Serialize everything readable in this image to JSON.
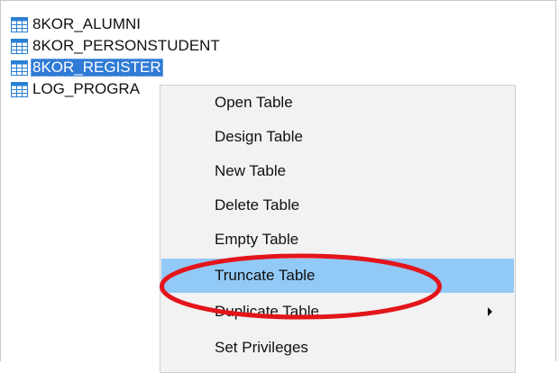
{
  "tables": [
    {
      "name": "8KOR_ALUMNI",
      "selected": false
    },
    {
      "name": "8KOR_PERSONSTUDENT",
      "selected": false
    },
    {
      "name": "8KOR_REGISTER",
      "selected": true
    },
    {
      "name": "LOG_PROGRA",
      "selected": false
    }
  ],
  "context_menu": {
    "items": [
      {
        "label": "Open Table"
      },
      {
        "label": "Design Table"
      },
      {
        "label": "New Table"
      },
      {
        "label": "Delete Table"
      },
      {
        "label": "Empty Table"
      },
      {
        "label": "Truncate Table",
        "highlighted": true
      },
      {
        "label": "Duplicate Table",
        "has_submenu": true
      },
      {
        "label": "Set Privileges"
      }
    ]
  },
  "colors": {
    "selection": "#2f7bd6",
    "menu_highlight": "#91c9f7",
    "annotation": "#e3151b",
    "table_icon": "#2a7fd4"
  },
  "icons": {
    "table": "table-grid-icon",
    "submenu": "chevron-right-icon"
  }
}
